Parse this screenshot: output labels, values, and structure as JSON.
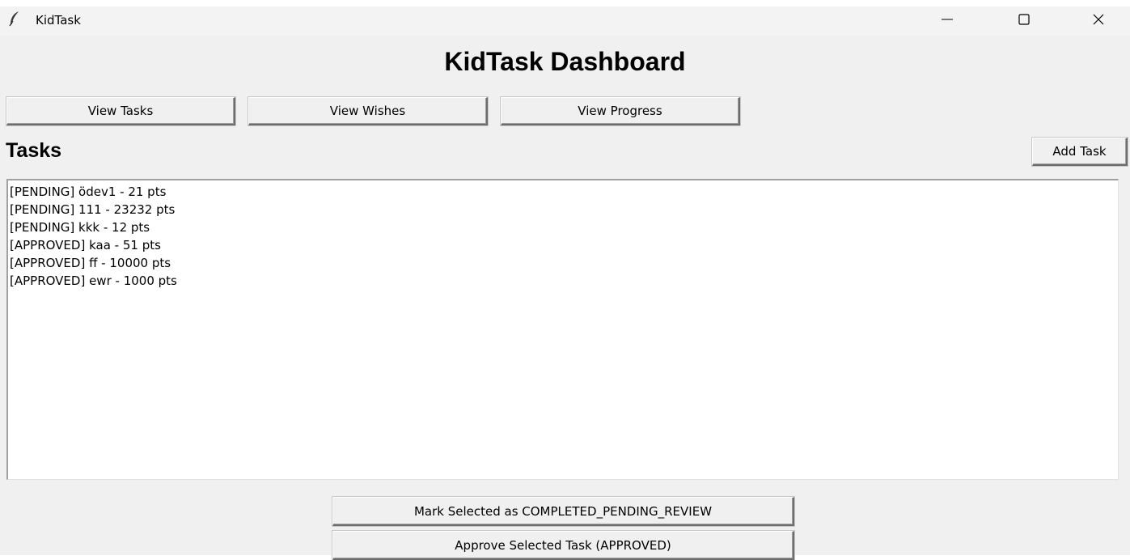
{
  "window": {
    "title": "KidTask",
    "icon": "feather-icon",
    "controls": {
      "minimize": "minimize-icon",
      "maximize": "maximize-icon",
      "close": "close-icon"
    }
  },
  "header": {
    "title": "KidTask Dashboard"
  },
  "nav": {
    "view_tasks": "View Tasks",
    "view_wishes": "View Wishes",
    "view_progress": "View Progress"
  },
  "tasks": {
    "heading": "Tasks",
    "add_task_label": "Add Task",
    "items": [
      "[PENDING] ödev1 - 21 pts",
      "[PENDING] 111 - 23232 pts",
      "[PENDING] kkk - 12 pts",
      "[APPROVED] kaa - 51 pts",
      "[APPROVED] ff - 10000 pts",
      "[APPROVED] ewr - 1000 pts"
    ]
  },
  "actions": {
    "mark_completed": "Mark Selected as COMPLETED_PENDING_REVIEW",
    "approve": "Approve Selected Task (APPROVED)"
  },
  "colors": {
    "window_bg": "#f0f0f0",
    "titlebar_bg": "#f3f3f3",
    "list_bg": "#ffffff",
    "text": "#000000"
  }
}
